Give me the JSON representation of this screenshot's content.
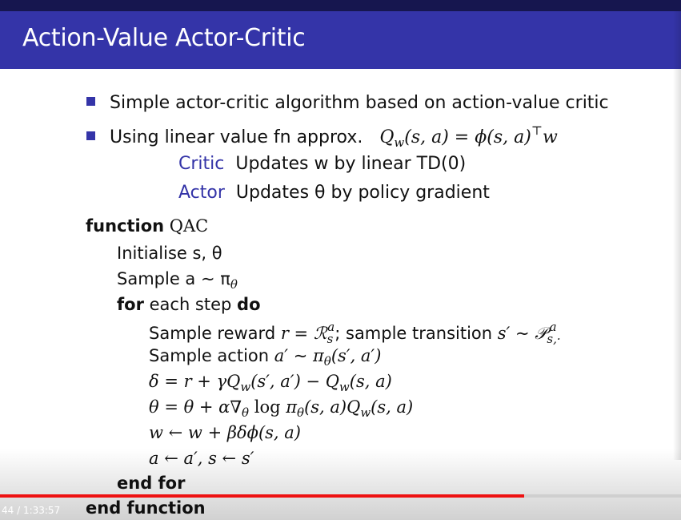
{
  "slide": {
    "title": "Action-Value Actor-Critic",
    "bullets": [
      "Simple actor-critic algorithm based on action-value critic",
      "Using linear value fn approx."
    ],
    "critic_label": "Critic",
    "critic_text": "Updates w by linear TD(0)",
    "actor_label": "Actor",
    "actor_text": "Updates θ by policy gradient",
    "algorithm": {
      "header_kw": "function",
      "name": "QAC",
      "init": "Initialise s, θ",
      "sample_action": "Sample a ∼ π",
      "for_kw": "for",
      "for_text": "each step",
      "do_kw": "do",
      "end_for": "end for",
      "end_function": "end function"
    }
  },
  "player": {
    "time_display": "44 / 1:33:57",
    "progress_fraction": 0.77
  },
  "colors": {
    "title_bar": "#3434a8",
    "accent": "#3434a8",
    "progress": "#ee1111"
  }
}
